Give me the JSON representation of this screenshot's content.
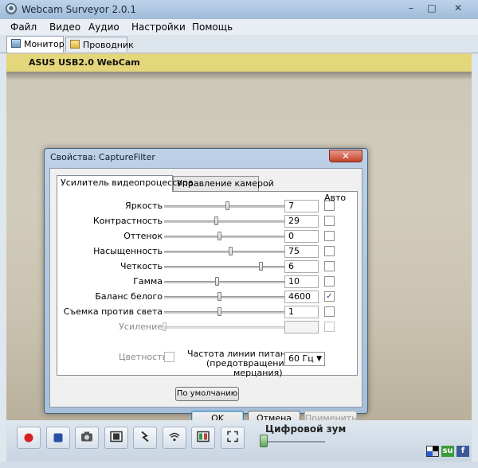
{
  "window": {
    "title": "Webcam Surveyor 2.0.1",
    "minimize": "–",
    "maximize": "□",
    "close": "✕"
  },
  "menu": [
    "Файл",
    "Видео",
    "Аудио",
    "Настройки",
    "Помощь"
  ],
  "app_tabs": [
    {
      "label": "Монитор",
      "active": true
    },
    {
      "label": "Проводник",
      "active": false
    }
  ],
  "camera": {
    "name": "ASUS USB2.0 WebCam"
  },
  "dialog": {
    "title": "Свойства: CaptureFilter",
    "close": "✕",
    "tabs": [
      "Усилитель видеопроцессора",
      "Управление камерой"
    ],
    "auto_header": "Авто",
    "rows": [
      {
        "label": "Яркость",
        "value": "7",
        "slider": 0.52,
        "auto": false,
        "enabled": true
      },
      {
        "label": "Контрастность",
        "value": "29",
        "slider": 0.43,
        "auto": false,
        "enabled": true
      },
      {
        "label": "Оттенок",
        "value": "0",
        "slider": 0.46,
        "auto": false,
        "enabled": true
      },
      {
        "label": "Насыщенность",
        "value": "75",
        "slider": 0.55,
        "auto": false,
        "enabled": true
      },
      {
        "label": "Четкость",
        "value": "6",
        "slider": 0.8,
        "auto": false,
        "enabled": true
      },
      {
        "label": "Гамма",
        "value": "10",
        "slider": 0.44,
        "auto": false,
        "enabled": true
      },
      {
        "label": "Баланс белого",
        "value": "4600",
        "slider": 0.46,
        "auto": true,
        "enabled": true
      },
      {
        "label": "Съемка против света",
        "value": "1",
        "slider": 0.46,
        "auto": false,
        "enabled": true
      },
      {
        "label": "Усиление",
        "value": "",
        "slider": 0.0,
        "auto": false,
        "enabled": false
      }
    ],
    "color_label": "Цветность",
    "powerline_lines": [
      "Частота линии питания",
      "(предотвращение",
      "мерцания)"
    ],
    "powerline_value": "60 Гц",
    "default_button": "По умолчанию",
    "ok": "OK",
    "cancel": "Отмена",
    "apply": "Применить"
  },
  "toolbar": {
    "zoom_label": "Цифровой зум",
    "zoom_level": 0.0,
    "icons": [
      "record-icon",
      "save-icon",
      "snapshot-icon",
      "video-clip-icon",
      "motion-detect-icon",
      "broadcast-icon",
      "camera-settings-icon",
      "fullscreen-icon"
    ],
    "social": [
      "delicious-icon",
      "stumbleupon-icon",
      "facebook-icon"
    ]
  },
  "colors": {
    "camera_header": "#e4d67a",
    "record": "#d62020",
    "save": "#2b4fa6"
  }
}
